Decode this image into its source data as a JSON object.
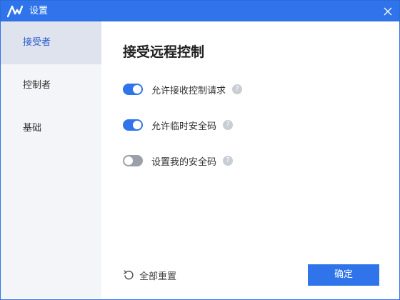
{
  "window": {
    "title": "设置",
    "logo_icon": "app-logo-icon",
    "close_icon": "close-icon"
  },
  "sidebar": {
    "items": [
      {
        "label": "接受者",
        "active": true
      },
      {
        "label": "控制者",
        "active": false
      },
      {
        "label": "基础",
        "active": false
      }
    ]
  },
  "main": {
    "heading": "接受远程控制",
    "options": [
      {
        "label": "允许接收控制请求",
        "enabled": true,
        "help_icon": "help-icon"
      },
      {
        "label": "允许临时安全码",
        "enabled": true,
        "help_icon": "help-icon"
      },
      {
        "label": "设置我的安全码",
        "enabled": false,
        "help_icon": "help-icon"
      }
    ]
  },
  "footer": {
    "reset_label": "全部重置",
    "reset_icon": "reset-icon",
    "confirm_label": "确定"
  },
  "colors": {
    "accent": "#2f74ea",
    "sidebar_bg": "#f4f5f9",
    "active_item_bg": "#dfe3ee",
    "toggle_off": "#9aa0a8"
  }
}
